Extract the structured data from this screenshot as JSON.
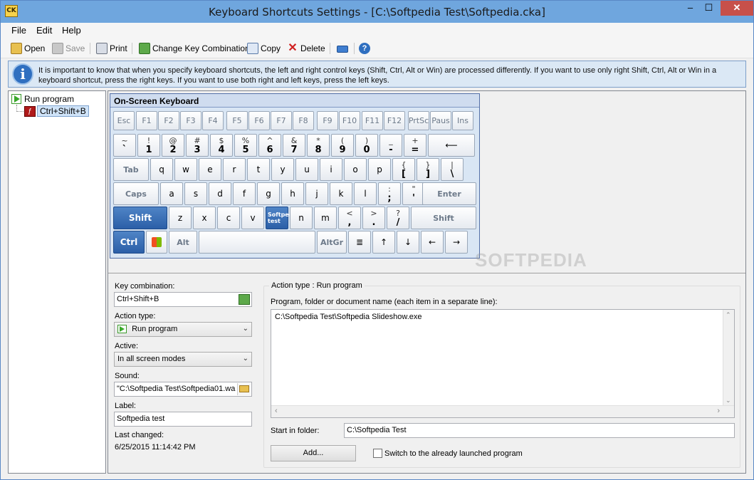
{
  "window": {
    "title": "Keyboard Shortcuts Settings - [C:\\Softpedia Test\\Softpedia.cka]",
    "app_icon_text": "CK",
    "min_label": "–",
    "max_label": "☐",
    "close_label": "✕"
  },
  "menu": {
    "file": "File",
    "edit": "Edit",
    "help": "Help"
  },
  "toolbar": {
    "open": "Open",
    "save": "Save",
    "print": "Print",
    "change_key": "Change Key Combination",
    "copy": "Copy",
    "delete": "Delete"
  },
  "info": {
    "text": "It is important to know that when you specify keyboard shortcuts, the left and right control keys (Shift, Ctrl, Alt or Win) are processed differently. If you want to use only right Shift, Ctrl, Alt or Win in a keyboard shortcut, press the right keys. If you want to use both right and left keys, press the left keys."
  },
  "tree": {
    "root": "Run program",
    "child": "Ctrl+Shift+B"
  },
  "keyboard": {
    "title": "On-Screen Keyboard",
    "row1": [
      "Esc",
      "F1",
      "F2",
      "F3",
      "F4",
      "F5",
      "F6",
      "F7",
      "F8",
      "F9",
      "F10",
      "F11",
      "F12",
      "PrtSc",
      "Paus",
      "Ins"
    ],
    "row2": [
      {
        "t": "~",
        "b": "`"
      },
      {
        "t": "!",
        "b": "1"
      },
      {
        "t": "@",
        "b": "2"
      },
      {
        "t": "#",
        "b": "3"
      },
      {
        "t": "$",
        "b": "4"
      },
      {
        "t": "%",
        "b": "5"
      },
      {
        "t": "^",
        "b": "6"
      },
      {
        "t": "&",
        "b": "7"
      },
      {
        "t": "*",
        "b": "8"
      },
      {
        "t": "(",
        "b": "9"
      },
      {
        "t": ")",
        "b": "0"
      },
      {
        "t": "_",
        "b": "-"
      },
      {
        "t": "+",
        "b": "="
      }
    ],
    "backspace": "⟵",
    "tab": "Tab",
    "row3": [
      "q",
      "w",
      "e",
      "r",
      "t",
      "y",
      "u",
      "i",
      "o",
      "p"
    ],
    "row3b": [
      {
        "t": "{",
        "b": "["
      },
      {
        "t": "}",
        "b": "]"
      },
      {
        "t": "|",
        "b": "\\"
      }
    ],
    "caps": "Caps",
    "row4": [
      "a",
      "s",
      "d",
      "f",
      "g",
      "h",
      "j",
      "k",
      "l"
    ],
    "row4b": [
      {
        "t": ":",
        "b": ";"
      },
      {
        "t": "\"",
        "b": "'"
      }
    ],
    "enter": "Enter",
    "shift_left": "Shift",
    "row5": [
      "z",
      "x",
      "c",
      "v"
    ],
    "b_key": "Softpedia test",
    "row5b": [
      "n",
      "m"
    ],
    "row5c": [
      {
        "t": "<",
        "b": ","
      },
      {
        "t": ">",
        "b": "."
      },
      {
        "t": "?",
        "b": "/"
      }
    ],
    "shift_right": "Shift",
    "ctrl": "Ctrl",
    "alt": "Alt",
    "altgr": "AltGr",
    "arrows": [
      "↑",
      "↓",
      "←",
      "→"
    ]
  },
  "form": {
    "key_combination_label": "Key combination:",
    "key_combination_value": "Ctrl+Shift+B",
    "action_type_label": "Action type:",
    "action_type_value": "Run program",
    "active_label": "Active:",
    "active_value": "In all screen modes",
    "sound_label": "Sound:",
    "sound_value": "\"C:\\Softpedia Test\\Softpedia01.wa",
    "label_label": "Label:",
    "label_value": "Softpedia test",
    "last_changed_label": "Last changed:",
    "last_changed_value": "6/25/2015 11:14:42 PM"
  },
  "action": {
    "group_title": "Action type : Run program",
    "program_label": "Program, folder or document name (each item in a separate line):",
    "program_value": "C:\\Softpedia Test\\Softpedia Slideshow.exe",
    "start_label": "Start in folder:",
    "start_value": "C:\\Softpedia Test",
    "add_button": "Add...",
    "switch_label": "Switch to the already launched program"
  },
  "watermark": "SOFTPEDIA",
  "colors": {
    "titlebar": "#6fa6de",
    "close": "#c7504a",
    "key_active": "#2b5fa8",
    "info_bg": "#dbe8f5"
  }
}
